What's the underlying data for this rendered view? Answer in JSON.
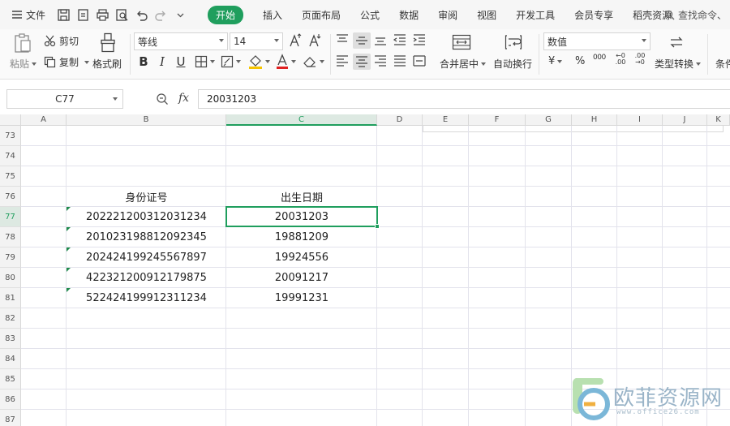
{
  "menubar": {
    "file_label": "文件",
    "tabs": [
      "开始",
      "插入",
      "页面布局",
      "公式",
      "数据",
      "审阅",
      "视图",
      "开发工具",
      "会员专享",
      "稻壳资源"
    ],
    "active_tab": 0,
    "search_label": "查找命令、"
  },
  "ribbon": {
    "paste": "粘贴",
    "cut": "剪切",
    "copy": "复制",
    "format_painter": "格式刷",
    "font_name": "等线",
    "font_size": "14",
    "bold": "B",
    "italic": "I",
    "underline": "U",
    "merge_center": "合并居中",
    "wrap_text": "自动换行",
    "number_format": "数值",
    "currency": "¥",
    "percent": "%",
    "thousands": "000",
    "inc_decimal": "←0 .00",
    "dec_decimal": ".00 →0",
    "type_convert": "类型转换",
    "conditional": "条件"
  },
  "formula_bar": {
    "cell_ref": "C77",
    "fx": "fx",
    "content": "20031203"
  },
  "grid": {
    "columns": [
      "A",
      "B",
      "C",
      "D",
      "E",
      "F",
      "G",
      "H",
      "I",
      "J",
      "K"
    ],
    "selected_column": "C",
    "rows": [
      "73",
      "74",
      "75",
      "76",
      "77",
      "78",
      "79",
      "80",
      "81",
      "82",
      "83",
      "84",
      "85",
      "86",
      "87"
    ],
    "selected_row": "77",
    "header_b": "身份证号",
    "header_c": "出生日期",
    "data": [
      {
        "id": "202221200312031234",
        "birth": "20031203"
      },
      {
        "id": "201023198812092345",
        "birth": "19881209"
      },
      {
        "id": "202424199245567897",
        "birth": "19924556"
      },
      {
        "id": "422321200912179875",
        "birth": "20091217"
      },
      {
        "id": "522424199912311234",
        "birth": "19991231"
      }
    ]
  },
  "watermark": {
    "title": "欧菲资源网",
    "url": "www.office26.com"
  },
  "colors": {
    "accent": "#1f9e5d",
    "font_color_red": "#e02020",
    "fill_yellow": "#f5c400"
  }
}
